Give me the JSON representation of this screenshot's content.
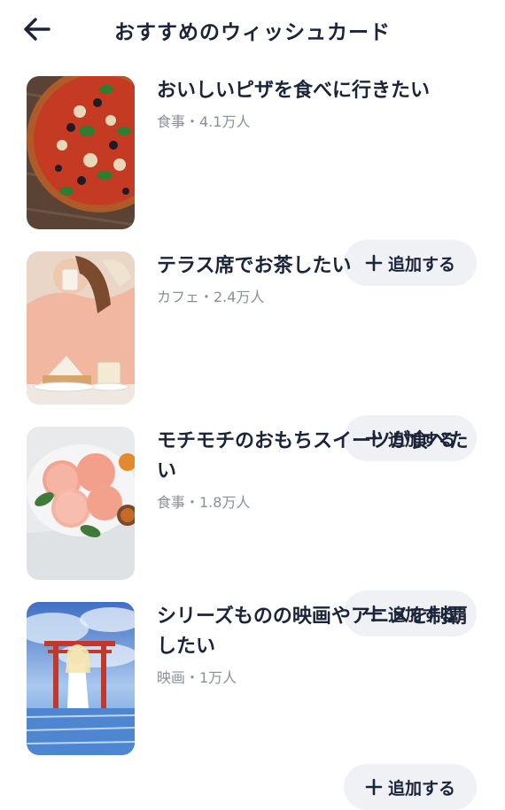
{
  "header": {
    "back_icon": "arrow-left-icon",
    "title": "おすすめのウィッシュカード"
  },
  "cards": [
    {
      "title": "おいしいピザを食べに行きたい",
      "meta": "食事・4.1万人",
      "add_label": "追加する",
      "image": "pizza-photo"
    },
    {
      "title": "テラス席でお茶したい",
      "meta": "カフェ・2.4万人",
      "add_label": "追加する",
      "image": "cafe-tea-photo"
    },
    {
      "title": "モチモチのおもちスイーツが食べたい",
      "meta": "食事・1.8万人",
      "add_label": "追加する",
      "image": "mochi-sweets-photo"
    },
    {
      "title": "シリーズものの映画やアニメを制覇したい",
      "meta": "映画・1万人",
      "add_label": "追加する",
      "image": "anime-torii-illustration"
    }
  ],
  "colors": {
    "text": "#1b2438",
    "meta": "#8a8f99",
    "button_bg": "#f0f1f4"
  }
}
